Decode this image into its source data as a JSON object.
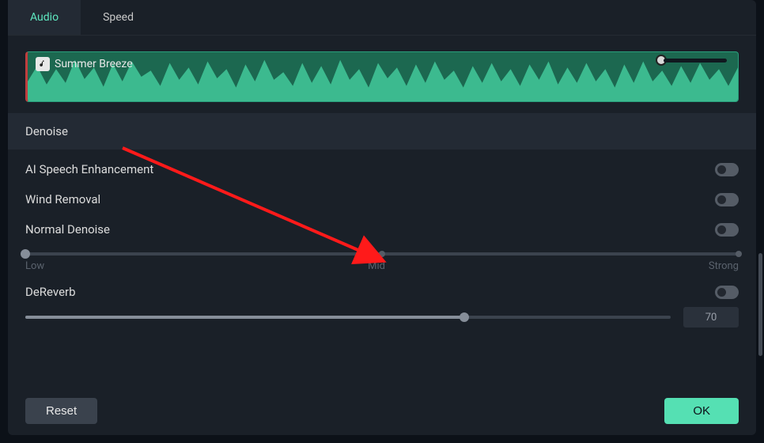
{
  "tabs": {
    "audio": "Audio",
    "speed": "Speed",
    "active": "audio"
  },
  "clip": {
    "title": "Summer Breeze"
  },
  "section": {
    "denoise": "Denoise"
  },
  "options": {
    "ai_speech": {
      "label": "AI Speech Enhancement",
      "enabled": false
    },
    "wind": {
      "label": "Wind Removal",
      "enabled": false
    },
    "normal_denoise": {
      "label": "Normal Denoise",
      "enabled": false,
      "slider": {
        "percent": 0,
        "labels": {
          "low": "Low",
          "mid": "Mid",
          "strong": "Strong"
        }
      }
    },
    "dereverb": {
      "label": "DeReverb",
      "enabled": false,
      "value": "70",
      "slider_percent": 68
    }
  },
  "footer": {
    "reset": "Reset",
    "ok": "OK"
  },
  "colors": {
    "accent": "#5ee8c0",
    "waveform": "#3cba8f"
  }
}
